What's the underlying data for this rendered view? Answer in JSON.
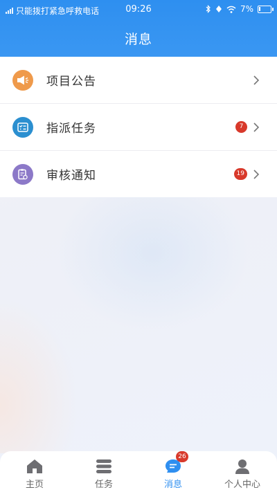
{
  "status_bar": {
    "carrier_text": "只能拨打紧急呼救电话",
    "time": "09:26",
    "battery": "7%",
    "icons": [
      "signal-icon",
      "bluetooth-icon",
      "alarm-icon",
      "wifi-icon",
      "battery-icon"
    ]
  },
  "header": {
    "title": "消息"
  },
  "messages": {
    "items": [
      {
        "label": "项目公告",
        "icon": "announcement-icon",
        "icon_color": "#ef9a4b",
        "badge": null
      },
      {
        "label": "指派任务",
        "icon": "task-list-icon",
        "icon_color": "#2b8fd0",
        "badge": "7"
      },
      {
        "label": "审核通知",
        "icon": "review-icon",
        "icon_color": "#8c79c8",
        "badge": "19"
      }
    ]
  },
  "tabbar": {
    "tabs": [
      {
        "label": "主页",
        "icon": "home-icon"
      },
      {
        "label": "任务",
        "icon": "task-icon"
      },
      {
        "label": "消息",
        "icon": "message-icon",
        "badge": "26",
        "active": true
      },
      {
        "label": "个人中心",
        "icon": "user-icon"
      }
    ]
  },
  "colors": {
    "primary": "#2f8ff0",
    "badge": "#d8392b"
  }
}
